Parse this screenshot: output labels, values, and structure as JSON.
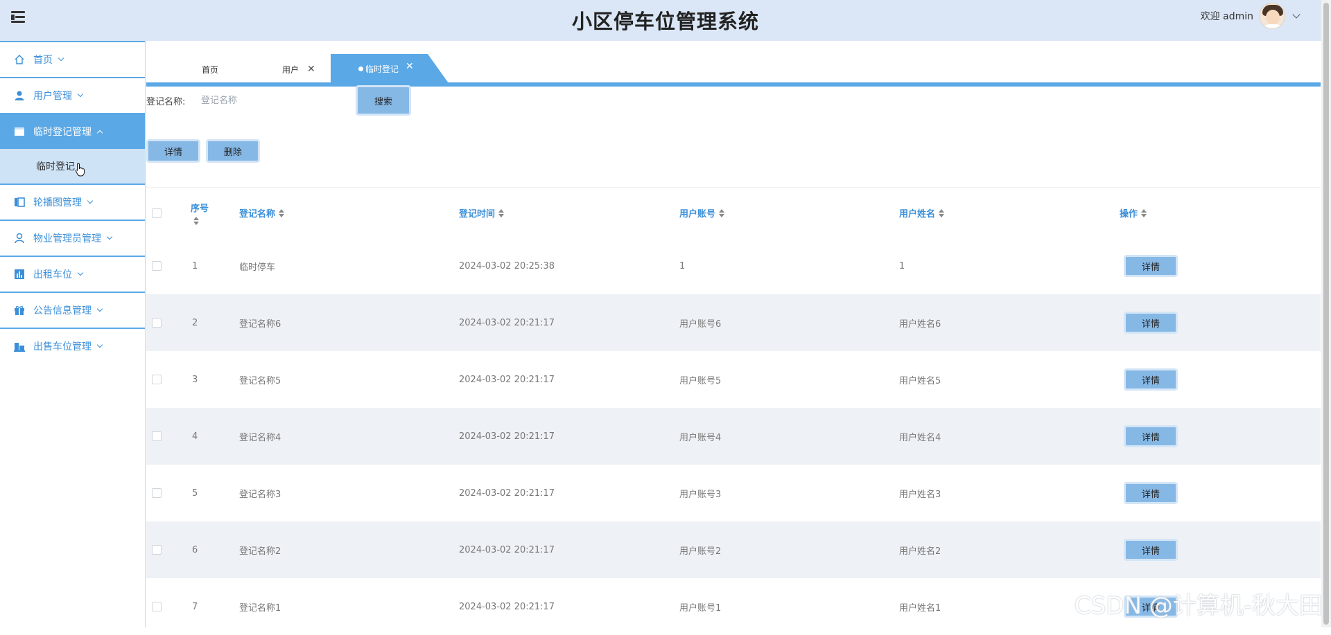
{
  "header": {
    "title": "小区停车位管理系统",
    "welcome": "欢迎 admin"
  },
  "sidebar": {
    "items": [
      {
        "label": "首页",
        "icon": "home-icon"
      },
      {
        "label": "用户管理",
        "icon": "user-icon"
      },
      {
        "label": "临时登记管理",
        "icon": "card-icon",
        "active": true
      },
      {
        "label": "轮播图管理",
        "icon": "carousel-icon"
      },
      {
        "label": "物业管理员管理",
        "icon": "admin-icon"
      },
      {
        "label": "出租车位",
        "icon": "chart-icon"
      },
      {
        "label": "公告信息管理",
        "icon": "gift-icon"
      },
      {
        "label": "出售车位管理",
        "icon": "building-icon"
      }
    ],
    "submenu": [
      {
        "label": "临时登记"
      }
    ]
  },
  "tabs": [
    {
      "label": "首页"
    },
    {
      "label": "用户"
    },
    {
      "label": "临时登记",
      "active": true
    }
  ],
  "search": {
    "label": "登记名称:",
    "placeholder": "登记名称",
    "button": "搜索"
  },
  "actions": {
    "detail": "详情",
    "delete": "删除"
  },
  "table": {
    "columns": [
      "序号",
      "登记名称",
      "登记时间",
      "用户账号",
      "用户姓名",
      "操作"
    ],
    "rows": [
      {
        "no": "1",
        "name": "临时停车",
        "time": "2024-03-02 20:25:38",
        "account": "1",
        "username": "1",
        "action": "详情"
      },
      {
        "no": "2",
        "name": "登记名称6",
        "time": "2024-03-02 20:21:17",
        "account": "用户账号6",
        "username": "用户姓名6",
        "action": "详情"
      },
      {
        "no": "3",
        "name": "登记名称5",
        "time": "2024-03-02 20:21:17",
        "account": "用户账号5",
        "username": "用户姓名5",
        "action": "详情"
      },
      {
        "no": "4",
        "name": "登记名称4",
        "time": "2024-03-02 20:21:17",
        "account": "用户账号4",
        "username": "用户姓名4",
        "action": "详情"
      },
      {
        "no": "5",
        "name": "登记名称3",
        "time": "2024-03-02 20:21:17",
        "account": "用户账号3",
        "username": "用户姓名3",
        "action": "详情"
      },
      {
        "no": "6",
        "name": "登记名称2",
        "time": "2024-03-02 20:21:17",
        "account": "用户账号2",
        "username": "用户姓名2",
        "action": "详情"
      },
      {
        "no": "7",
        "name": "登记名称1",
        "time": "2024-03-02 20:21:17",
        "account": "用户账号1",
        "username": "用户姓名1",
        "action": "详情"
      }
    ]
  },
  "watermark": "CSDN @计算机-秋大田",
  "colors": {
    "accent": "#5aa8e6",
    "header_bg": "#dbe7f6",
    "button_bg": "#86b8e6",
    "row_alt": "#eef1f5"
  }
}
